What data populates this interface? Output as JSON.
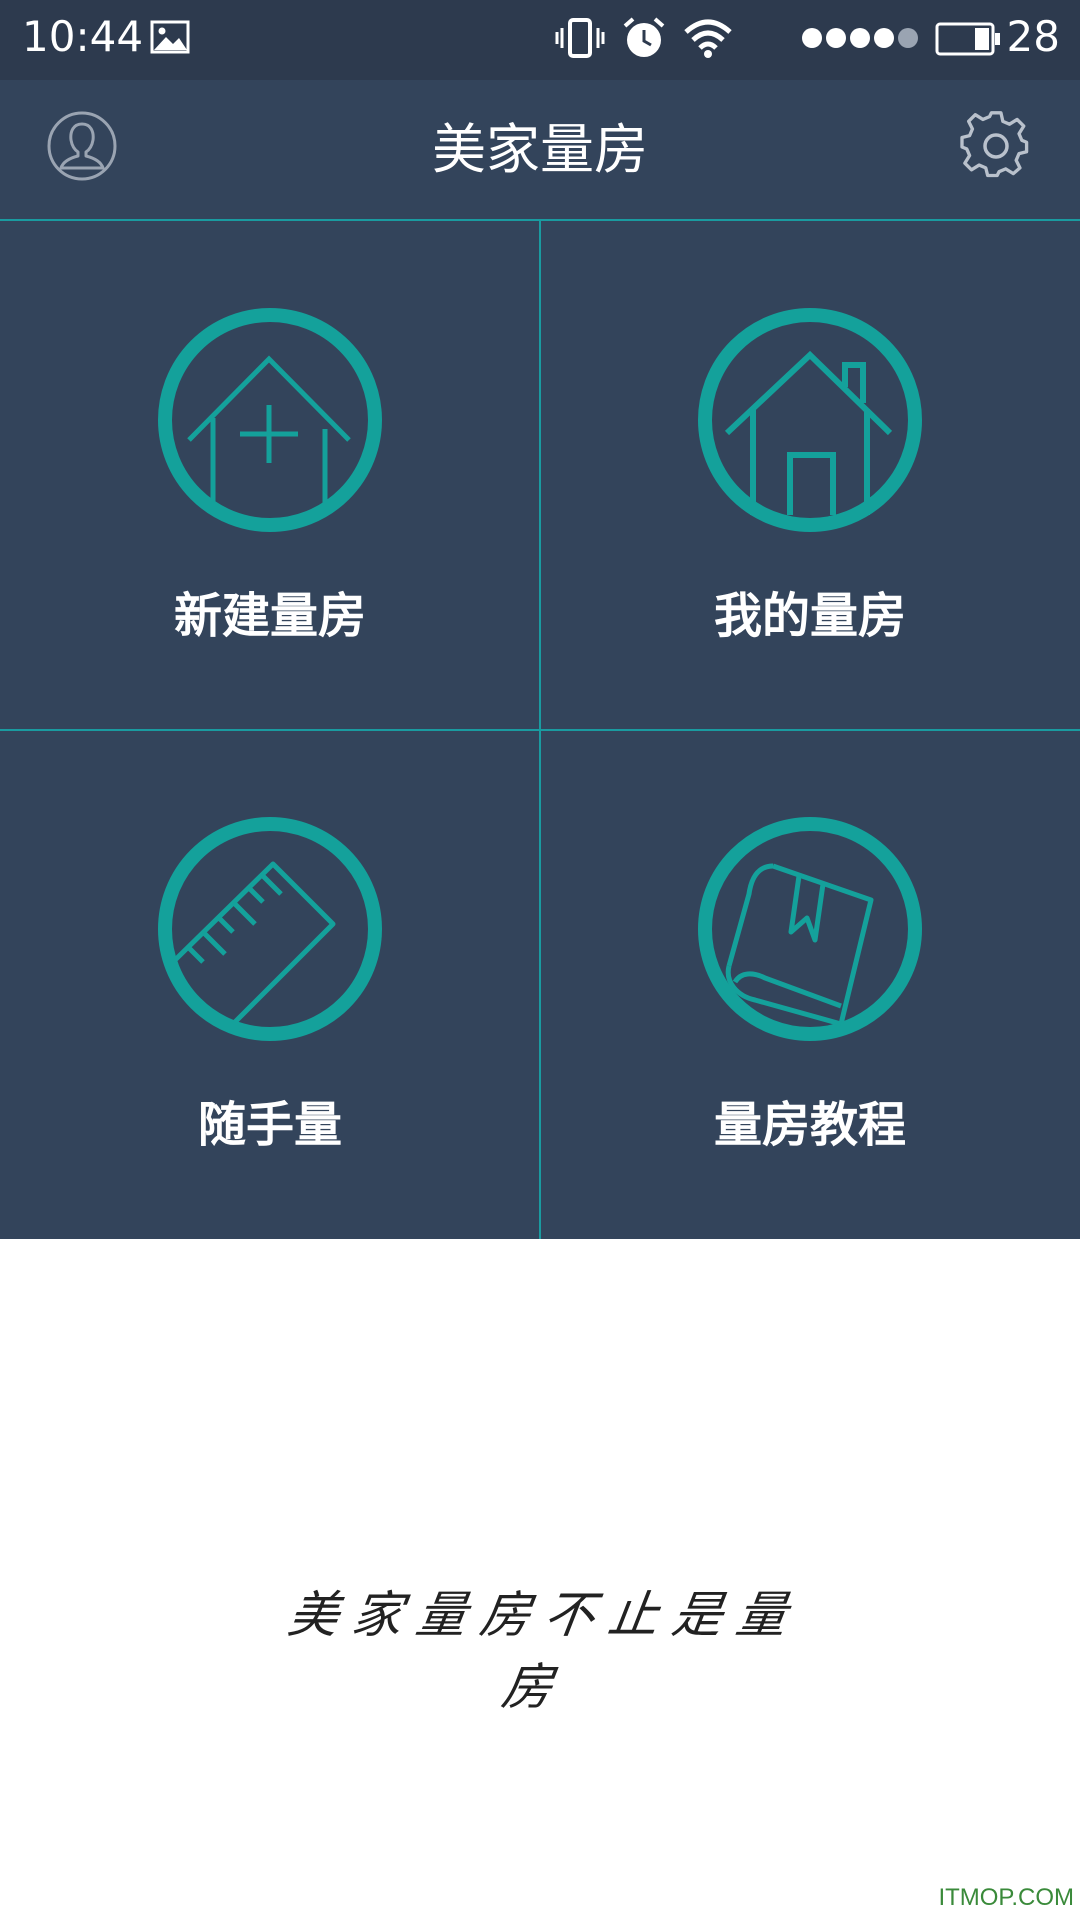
{
  "status_bar": {
    "time": "10:44",
    "battery_level": "28"
  },
  "app_bar": {
    "title": "美家量房",
    "profile_icon": "user-profile-icon",
    "settings_icon": "gear-icon"
  },
  "menu": {
    "items": [
      {
        "label": "新建量房",
        "icon": "house-plus-icon"
      },
      {
        "label": "我的量房",
        "icon": "house-icon"
      },
      {
        "label": "随手量",
        "icon": "ruler-icon"
      },
      {
        "label": "量房教程",
        "icon": "book-icon"
      }
    ]
  },
  "slogan": "美家量房不止是量房",
  "watermark": "ITMOP.COM",
  "colors": {
    "header_bg": "#33445b",
    "status_bg": "#2d3a4e",
    "accent_teal": "#1a9ba0",
    "icon_teal": "#14a19b"
  }
}
